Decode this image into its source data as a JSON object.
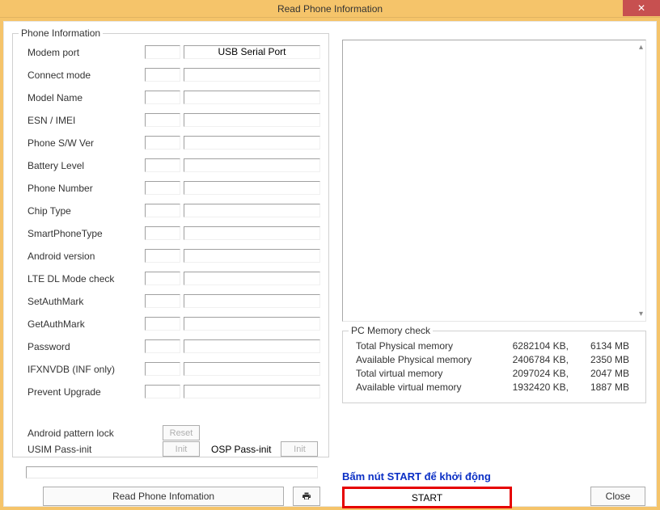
{
  "window": {
    "title": "Read Phone Information",
    "close_glyph": "✕"
  },
  "phone_info": {
    "legend": "Phone Information",
    "rows": [
      {
        "label": "Modem port",
        "long": "USB Serial Port"
      },
      {
        "label": "Connect mode",
        "long": ""
      },
      {
        "label": "Model Name",
        "long": ""
      },
      {
        "label": "ESN / IMEI",
        "long": ""
      },
      {
        "label": "Phone S/W Ver",
        "long": ""
      },
      {
        "label": "Battery Level",
        "long": ""
      },
      {
        "label": "Phone Number",
        "long": ""
      },
      {
        "label": "Chip Type",
        "long": ""
      },
      {
        "label": "SmartPhoneType",
        "long": ""
      },
      {
        "label": "Android version",
        "long": ""
      },
      {
        "label": "LTE DL Mode check",
        "long": ""
      },
      {
        "label": "SetAuthMark",
        "long": ""
      },
      {
        "label": "GetAuthMark",
        "long": ""
      },
      {
        "label": "Password",
        "long": ""
      },
      {
        "label": "IFXNVDB (INF only)",
        "long": ""
      },
      {
        "label": "Prevent Upgrade",
        "long": ""
      }
    ],
    "pattern_lock": {
      "label": "Android pattern lock",
      "btn": "Reset"
    },
    "usim": {
      "label": "USIM Pass-init",
      "btn": "Init"
    },
    "osp": {
      "label": "OSP Pass-init",
      "btn": "Init"
    },
    "read_btn": "Read Phone Infomation"
  },
  "mem": {
    "legend": "PC Memory check",
    "rows": [
      {
        "label": "Total Physical memory",
        "kb": "6282104 KB,",
        "mb": "6134 MB"
      },
      {
        "label": "Available Physical memory",
        "kb": "2406784 KB,",
        "mb": "2350 MB"
      },
      {
        "label": "Total virtual memory",
        "kb": "2097024 KB,",
        "mb": "2047 MB"
      },
      {
        "label": "Available virtual memory",
        "kb": "1932420 KB,",
        "mb": "1887 MB"
      }
    ]
  },
  "hint": "Bấm nút START để khởi động",
  "start": "START",
  "close": "Close"
}
